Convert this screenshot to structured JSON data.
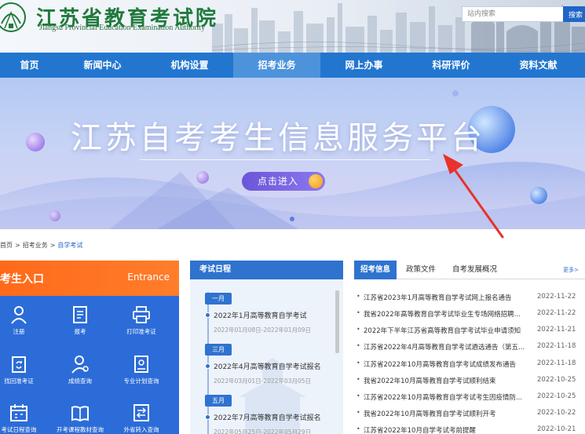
{
  "header": {
    "site_title": "江苏省教育考试院",
    "site_subtitle": "Jiangsu Provincial Education Examination Authority",
    "search_placeholder": "站内搜索",
    "search_button": "搜索"
  },
  "nav": {
    "items": [
      {
        "label": "首页",
        "active": false
      },
      {
        "label": "新闻中心",
        "active": false
      },
      {
        "label": "机构设置",
        "active": false
      },
      {
        "label": "招考业务",
        "active": true
      },
      {
        "label": "网上办事",
        "active": false
      },
      {
        "label": "科研评价",
        "active": false
      },
      {
        "label": "资料文献",
        "active": false
      }
    ]
  },
  "banner": {
    "title": "江苏自考考生信息服务平台",
    "enter_button": "点击进入"
  },
  "breadcrumb": {
    "items": [
      "首页",
      "招考业务",
      "自学考试"
    ],
    "separator": ">"
  },
  "entrance": {
    "title": "考生入口",
    "title_en": "Entrance",
    "items": [
      {
        "label": "注册",
        "icon": "user-icon"
      },
      {
        "label": "报考",
        "icon": "form-icon"
      },
      {
        "label": "打印准考证",
        "icon": "printer-icon"
      },
      {
        "label": "找回准考证",
        "icon": "refresh-card-icon"
      },
      {
        "label": "成绩查询",
        "icon": "user-search-icon"
      },
      {
        "label": "专业计划查询",
        "icon": "plan-icon"
      },
      {
        "label": "考试日程查询",
        "icon": "calendar-icon"
      },
      {
        "label": "开考课程教材查询",
        "icon": "book-icon"
      },
      {
        "label": "外省转入查询",
        "icon": "transfer-icon"
      }
    ]
  },
  "schedule": {
    "title": "考试日程",
    "entries": [
      {
        "month": "一月",
        "title": "2022年1月高等教育自学考试",
        "dates": "2022年01月08日-2022年01月09日"
      },
      {
        "month": "三月",
        "title": "2022年4月高等教育自学考试报名",
        "dates": "2022年03月01日-2022年03月05日"
      },
      {
        "month": "五月",
        "title": "2022年7月高等教育自学考试报名",
        "dates": "2022年05月25日-2022年05月29日"
      }
    ]
  },
  "news": {
    "tabs": [
      "招考信息",
      "政策文件",
      "自考发展概况"
    ],
    "more": "更多>",
    "items": [
      {
        "text": "江苏省2023年1月高等教育自学考试网上报名通告",
        "date": "2022-11-22"
      },
      {
        "text": "我省2022年高等教育自学考试毕业生专场网络招聘...",
        "date": "2022-11-22"
      },
      {
        "text": "2022年下半年江苏省高等教育自学考试毕业申请须知",
        "date": "2022-11-21"
      },
      {
        "text": "江苏省2022年4月高等教育自学考试遴选通告（第五...",
        "date": "2022-11-18"
      },
      {
        "text": "江苏省2022年10月高等教育自学考试成绩发布通告",
        "date": "2022-11-18"
      },
      {
        "text": "我省2022年10月高等教育自学考试顺利结束",
        "date": "2022-10-25"
      },
      {
        "text": "江苏省2022年10月高等教育自学考试考生因疫情防...",
        "date": "2022-10-25"
      },
      {
        "text": "我省2022年10月高等教育自学考试顺利开考",
        "date": "2022-10-22"
      },
      {
        "text": "江苏省2022年10月自学考试考前提醒",
        "date": "2022-10-21"
      }
    ]
  },
  "colors": {
    "nav_bg": "#2276cf",
    "entrance_head": "#ff6a1a",
    "entrance_body": "#2c6cd8",
    "arrow": "#e8322a"
  }
}
